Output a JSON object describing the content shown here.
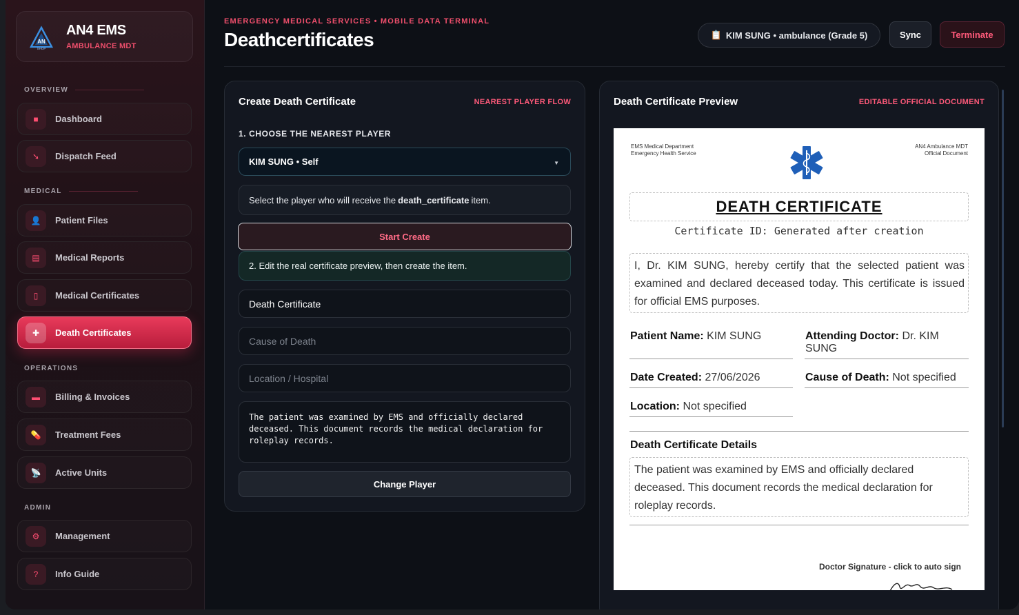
{
  "brand": {
    "title": "AN4 EMS",
    "subtitle": "AMBULANCE MDT",
    "logo_icon": "an4-shop-logo"
  },
  "sidebar": {
    "sections": [
      {
        "label": "OVERVIEW"
      },
      {
        "label": "MEDICAL"
      },
      {
        "label": "OPERATIONS"
      },
      {
        "label": "ADMIN"
      }
    ],
    "items": [
      {
        "label": "Dashboard",
        "icon": "dashboard-icon",
        "glyph": "■"
      },
      {
        "label": "Dispatch Feed",
        "icon": "dispatch-icon",
        "glyph": "➘"
      },
      {
        "label": "Patient Files",
        "icon": "patient-icon",
        "glyph": "👤"
      },
      {
        "label": "Medical Reports",
        "icon": "report-icon",
        "glyph": "▤"
      },
      {
        "label": "Medical Certificates",
        "icon": "certificate-icon",
        "glyph": "▯"
      },
      {
        "label": "Death Certificates",
        "icon": "plus-icon",
        "glyph": "✚"
      },
      {
        "label": "Billing & Invoices",
        "icon": "card-icon",
        "glyph": "▬"
      },
      {
        "label": "Treatment Fees",
        "icon": "pill-icon",
        "glyph": "💊"
      },
      {
        "label": "Active Units",
        "icon": "satellite-icon",
        "glyph": "📡"
      },
      {
        "label": "Management",
        "icon": "gear-icon",
        "glyph": "⚙"
      },
      {
        "label": "Info Guide",
        "icon": "question-icon",
        "glyph": "?"
      }
    ],
    "active_item": "Death Certificates",
    "accent_color": "#e83a5a"
  },
  "header": {
    "eyebrow": "EMERGENCY MEDICAL SERVICES • MOBILE DATA TERMINAL",
    "title": "Deathcertificates",
    "user_pill": "KIM SUNG • ambulance (Grade 5)",
    "sync_label": "Sync",
    "terminate_label": "Terminate"
  },
  "create_panel": {
    "title": "Create Death Certificate",
    "tag": "NEAREST PLAYER FLOW",
    "step1_label": "1. CHOOSE THE NEAREST PLAYER",
    "player_select_value": "KIM SUNG • Self",
    "info_prefix": "Select the player who will receive the",
    "info_item": "death_certificate",
    "info_suffix": "item.",
    "start_label": "Start Create",
    "step2_text": "2. Edit the real certificate preview, then create the item.",
    "title_field_value": "Death Certificate",
    "cause_placeholder": "Cause of Death",
    "location_placeholder": "Location / Hospital",
    "details_value": "The patient was examined by EMS and officially declared deceased. This document records the medical declaration for roleplay records.",
    "change_label": "Change Player"
  },
  "preview_panel": {
    "title": "Death Certificate Preview",
    "tag": "EDITABLE OFFICIAL DOCUMENT",
    "doc": {
      "header_left_1": "EMS Medical Department",
      "header_left_2": "Emergency Health Service",
      "header_right_1": "AN4 Ambulance MDT",
      "header_right_2": "Official Document",
      "emblem_icon": "star-of-life-icon",
      "title": "DEATH CERTIFICATE",
      "certificate_id": "Certificate ID: Generated after creation",
      "statement": "I, Dr. KIM SUNG, hereby certify that the selected patient was examined and declared deceased today. This certificate is issued for official EMS purposes.",
      "patient_name_label": "Patient Name:",
      "patient_name_value": "KIM SUNG",
      "doctor_label": "Attending Doctor:",
      "doctor_value": "Dr. KIM SUNG",
      "date_label": "Date Created:",
      "date_value": "27/06/2026",
      "cause_label": "Cause of Death:",
      "cause_value": "Not specified",
      "location_label": "Location:",
      "location_value": "Not specified",
      "details_title": "Death Certificate Details",
      "details_text": "The patient was examined by EMS and officially declared deceased. This document records the medical declaration for roleplay records.",
      "signature_label": "Doctor Signature - click to auto sign"
    }
  }
}
